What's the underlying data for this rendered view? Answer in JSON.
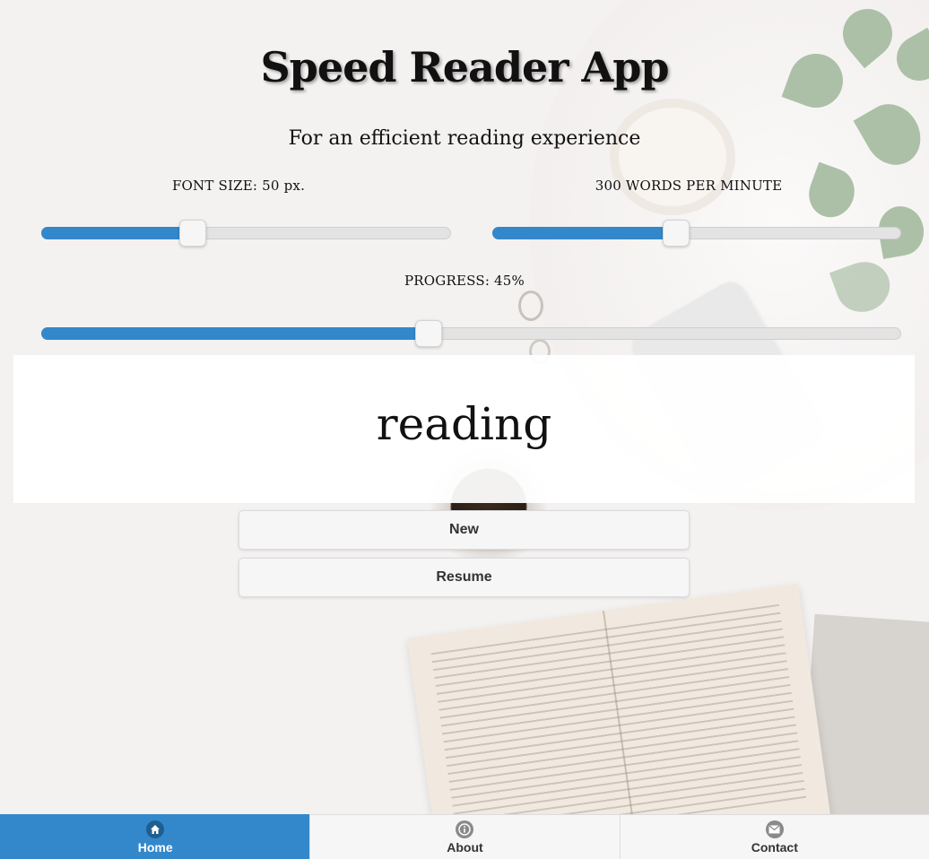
{
  "header": {
    "title": "Speed Reader App",
    "subtitle": "For an efficient reading experience"
  },
  "controls": {
    "font_size_label": "FONT SIZE: 50 px.",
    "font_size_value": 0.37,
    "wpm_label": "300 WORDS PER MINUTE",
    "wpm_value": 0.45,
    "progress_label": "PROGRESS: 45%",
    "progress_value": 0.45
  },
  "reader": {
    "current_word": "reading"
  },
  "buttons": {
    "new_label": "New",
    "resume_label": "Resume"
  },
  "navbar": {
    "items": [
      {
        "label": "Home",
        "icon": "home-icon",
        "active": true
      },
      {
        "label": "About",
        "icon": "info-icon",
        "active": false
      },
      {
        "label": "Contact",
        "icon": "mail-icon",
        "active": false
      }
    ]
  },
  "colors": {
    "accent": "#3388cc"
  }
}
